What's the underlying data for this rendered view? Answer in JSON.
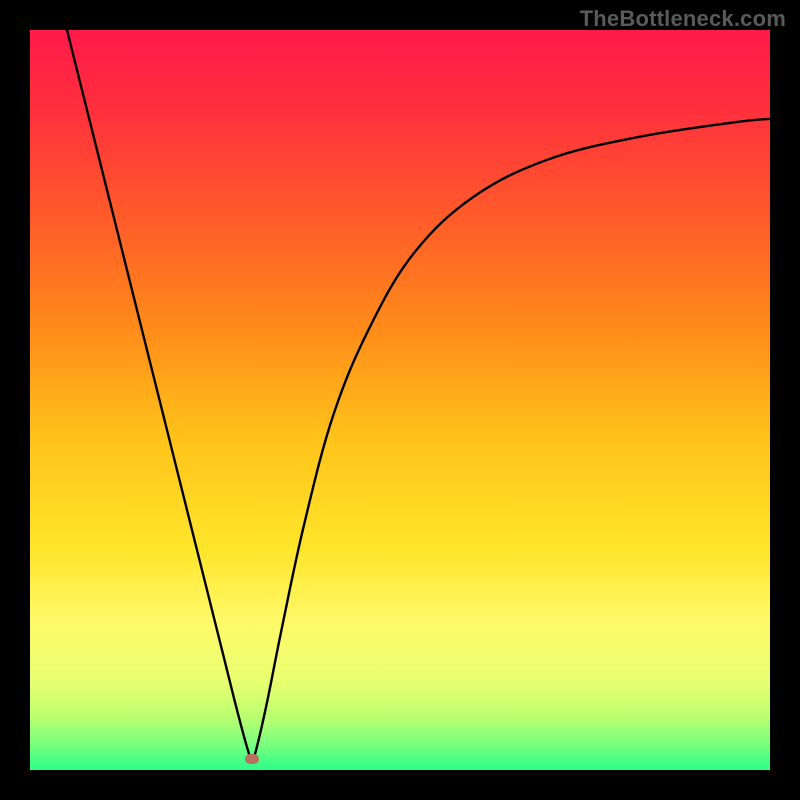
{
  "watermark": {
    "text": "TheBottleneck.com"
  },
  "colors": {
    "background": "#000000",
    "curve": "#000000",
    "marker": "#b87060",
    "gradient_stops": [
      {
        "offset": 0.0,
        "color": "#ff1a4a"
      },
      {
        "offset": 0.1,
        "color": "#ff2e3e"
      },
      {
        "offset": 0.25,
        "color": "#ff5a2a"
      },
      {
        "offset": 0.4,
        "color": "#ff8a1a"
      },
      {
        "offset": 0.55,
        "color": "#ffc21a"
      },
      {
        "offset": 0.7,
        "color": "#ffe52a"
      },
      {
        "offset": 0.8,
        "color": "#fff96a"
      },
      {
        "offset": 0.88,
        "color": "#e8ff70"
      },
      {
        "offset": 0.93,
        "color": "#b8ff70"
      },
      {
        "offset": 0.97,
        "color": "#70ff80"
      },
      {
        "offset": 1.0,
        "color": "#2aff8a"
      }
    ]
  },
  "chart_data": {
    "type": "line",
    "title": "",
    "xlabel": "",
    "ylabel": "",
    "xlim": [
      0,
      100
    ],
    "ylim": [
      0,
      100
    ],
    "grid": false,
    "annotations": [],
    "series": [
      {
        "name": "bottleneck-curve",
        "x": [
          5,
          8,
          11,
          14,
          17,
          20,
          23,
          26,
          28,
          29.5,
          30,
          30.5,
          32,
          34,
          37,
          41,
          46,
          52,
          60,
          70,
          82,
          95,
          100
        ],
        "values": [
          100,
          88,
          76,
          64,
          52,
          40,
          28,
          16,
          8,
          2.5,
          1.5,
          2.5,
          9,
          19,
          33,
          48,
          60,
          70,
          77.5,
          82.5,
          85.5,
          87.5,
          88
        ]
      }
    ],
    "marker": {
      "x": 30,
      "y": 1.5
    }
  }
}
